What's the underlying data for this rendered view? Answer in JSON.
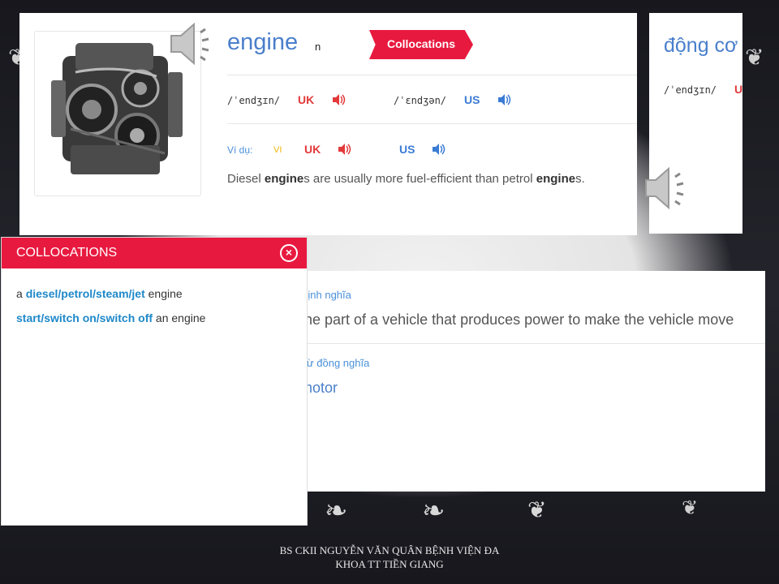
{
  "main_card": {
    "word": "engine",
    "part_of_speech": "n",
    "collocations_tag": "Collocations",
    "pron_uk_ipa": "/ˈendʒɪn/",
    "pron_uk_label": "UK",
    "pron_us_ipa": "/ˈɛndʒən/",
    "pron_us_label": "US",
    "example_label": "Ví dụ:",
    "example_lang": "VI",
    "example_uk_label": "UK",
    "example_us_label": "US",
    "example": {
      "p1": "Diesel ",
      "b1": "engine",
      "p2": "s are usually more fuel-efficient than petrol ",
      "b2": "engine",
      "p3": "s."
    }
  },
  "right_card": {
    "word": "động cơ",
    "ipa": "/ˈendʒɪn/",
    "uk_label": "U"
  },
  "collocations_panel": {
    "title": "COLLOCATIONS",
    "line1": {
      "pre": "a ",
      "highlight": "diesel/petrol/steam/jet",
      "post": " engine"
    },
    "line2": {
      "highlight": "start/switch on/switch off",
      "post": " an engine"
    }
  },
  "definition_card": {
    "definition_label": "Định nghĩa",
    "definition": "the part of a vehicle that produces power to make the vehicle move",
    "synonym_label": "Từ đồng nghĩa",
    "synonym": "motor"
  },
  "footer": {
    "line1": "BS CKII NGUYỄN VĂN QUÂN BỆNH VIỆN ĐA",
    "line2": "KHOA TT TIỀN GIANG"
  },
  "colors": {
    "accent_red": "#e8193f",
    "word_blue": "#4a7fcb",
    "uk_red": "#e23a3a",
    "us_blue": "#3a7bd5"
  },
  "icons": [
    "speaker-icon",
    "close-icon",
    "ornament-icon",
    "engine-image"
  ]
}
